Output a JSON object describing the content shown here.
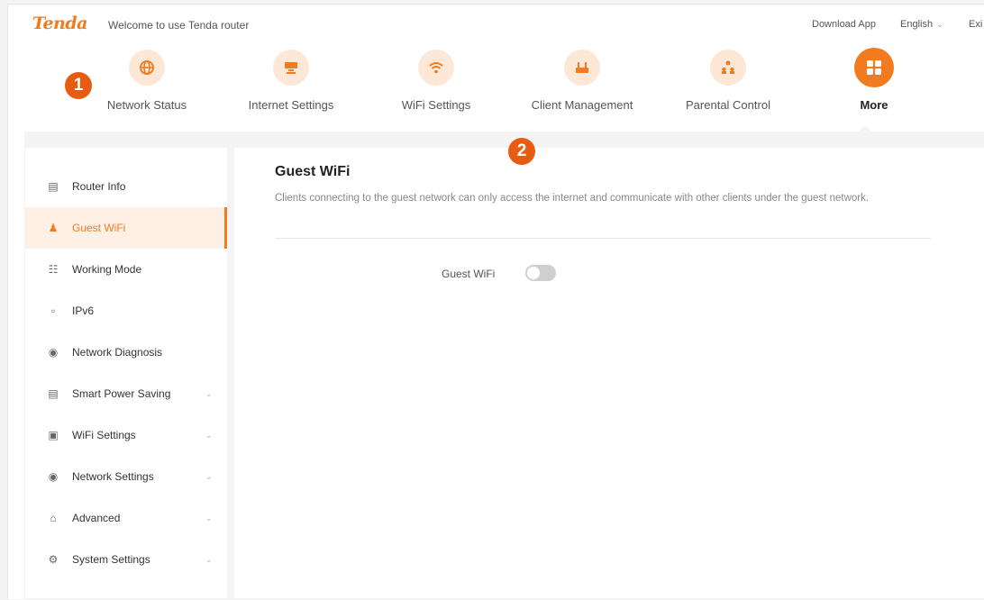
{
  "header": {
    "logo": "Tenda",
    "welcome": "Welcome to use Tenda router",
    "download_app": "Download App",
    "language": "English",
    "exit": "Exi"
  },
  "nav": {
    "items": [
      {
        "label": "Network Status",
        "icon": "globe-icon"
      },
      {
        "label": "Internet Settings",
        "icon": "internet-icon"
      },
      {
        "label": "WiFi Settings",
        "icon": "wifi-icon"
      },
      {
        "label": "Client Management",
        "icon": "router-icon"
      },
      {
        "label": "Parental Control",
        "icon": "parental-icon"
      },
      {
        "label": "More",
        "icon": "grid-icon",
        "active": true
      }
    ]
  },
  "badges": {
    "one": "1",
    "two": "2"
  },
  "sidebar": {
    "items": [
      {
        "label": "Router Info",
        "icon": "router-info-icon"
      },
      {
        "label": "Guest WiFi",
        "icon": "guest-icon",
        "active": true
      },
      {
        "label": "Working Mode",
        "icon": "working-mode-icon"
      },
      {
        "label": "IPv6",
        "icon": "ipv6-icon"
      },
      {
        "label": "Network Diagnosis",
        "icon": "globe-icon"
      },
      {
        "label": "Smart Power Saving",
        "icon": "power-saving-icon",
        "expandable": true
      },
      {
        "label": "WiFi Settings",
        "icon": "wifi-settings-icon",
        "expandable": true
      },
      {
        "label": "Network Settings",
        "icon": "globe-icon",
        "expandable": true
      },
      {
        "label": "Advanced",
        "icon": "advanced-icon",
        "expandable": true
      },
      {
        "label": "System Settings",
        "icon": "gear-icon",
        "expandable": true
      }
    ]
  },
  "panel": {
    "title": "Guest WiFi",
    "description": "Clients connecting to the guest network can only access the internet and communicate with other clients under the guest network.",
    "guest_wifi_label": "Guest WiFi",
    "guest_wifi_enabled": false
  },
  "colors": {
    "accent": "#f27b20",
    "accent_light": "#fde8d8",
    "badge": "#e85b12"
  }
}
